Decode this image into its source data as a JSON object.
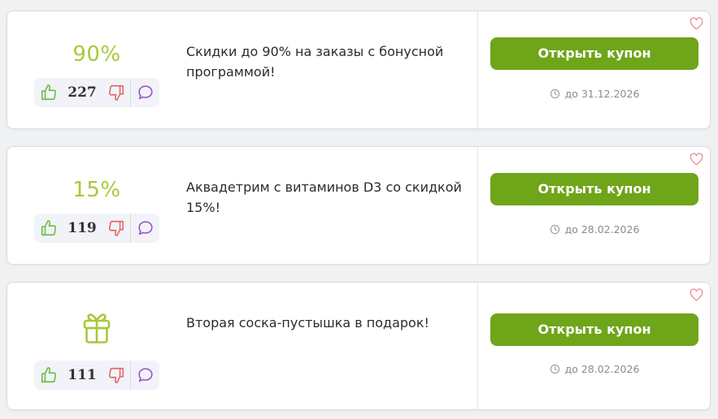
{
  "colors": {
    "accent": "#6ea519",
    "discount": "#a7c93a",
    "like": "#6cbf4a",
    "dislike": "#e36b6b",
    "comment": "#9b59c6",
    "heart": "#e88a96"
  },
  "coupons": [
    {
      "discount": "90%",
      "likes": "227",
      "description": "Скидки до 90% на заказы с бонусной программой!",
      "button_label": "Открыть купон",
      "expiry": "до 31.12.2026"
    },
    {
      "discount": "15%",
      "likes": "119",
      "description": "Аквадетрим с витаминов D3 со скидкой 15%!",
      "button_label": "Открыть купон",
      "expiry": "до 28.02.2026"
    },
    {
      "icon": "gift-icon",
      "likes": "111",
      "description": "Вторая соска-пустышка в подарок!",
      "button_label": "Открыть купон",
      "expiry": "до 28.02.2026"
    }
  ]
}
